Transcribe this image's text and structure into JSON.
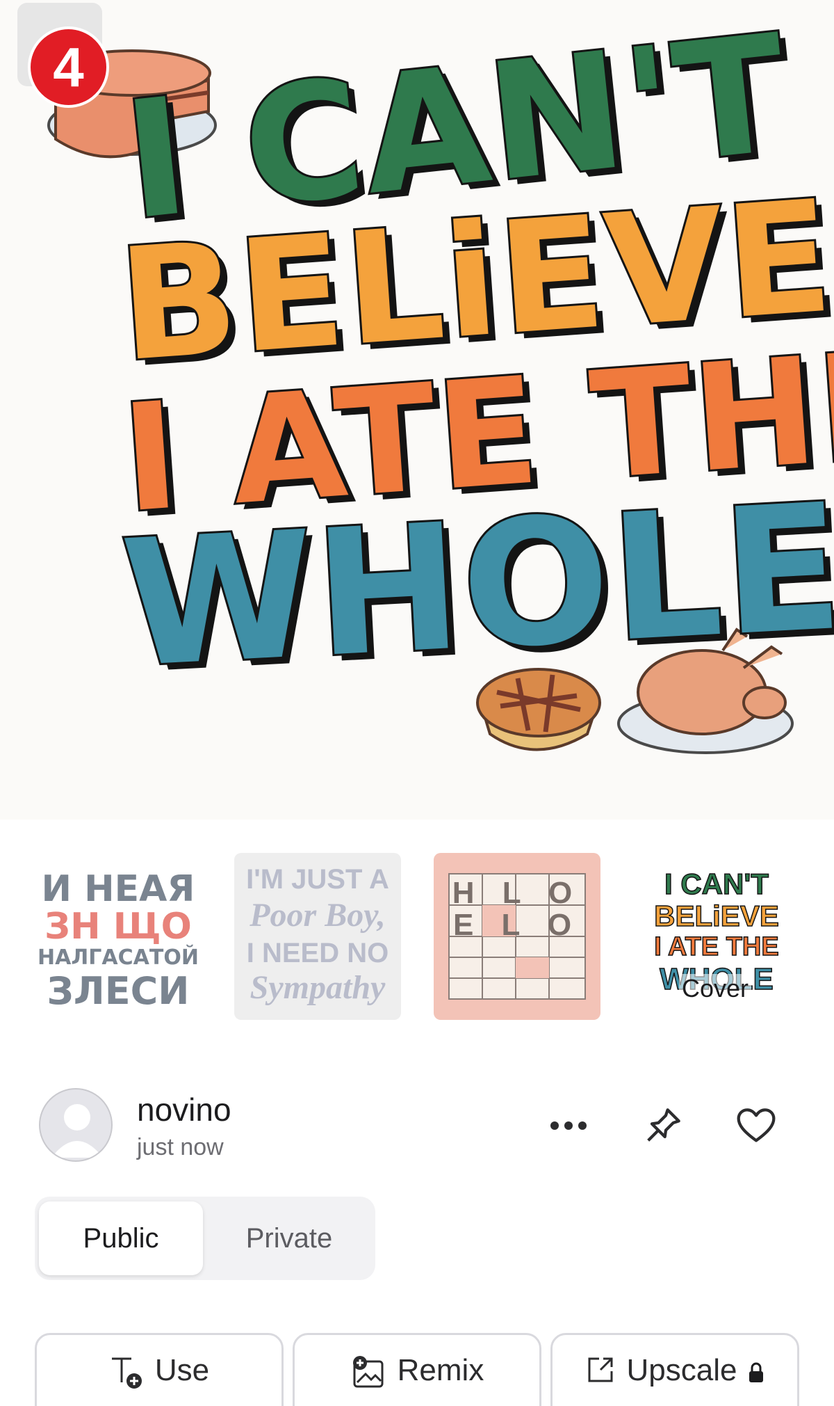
{
  "badge": {
    "count": "4"
  },
  "hero": {
    "lines": [
      "I CAN'T",
      "BELiEVE",
      "I ATE THE",
      "WHOLE"
    ]
  },
  "thumbnails": [
    {
      "lines": [
        "И НЕАЯ",
        "ЗН ЩО",
        "НАЛГАСАТОЙ",
        "ЗЛЕСИ"
      ],
      "colors": [
        "#7a8490",
        "#e8827a",
        "#7a8490",
        "#7a8490"
      ]
    },
    {
      "lines": [
        "I'M JUST A",
        "Poor Boy,",
        "I NEED NO",
        "Sympathy"
      ],
      "color": "#b9bccb"
    },
    {
      "lines": [
        "H  L O",
        "E  L O"
      ],
      "color": "#7a6f6a"
    },
    {
      "lines": [
        "I CAN'T",
        "BELiEVE",
        "I ATE THE",
        "WHOLE"
      ],
      "cover_label": "Cover"
    }
  ],
  "author": {
    "username": "novino",
    "timestamp": "just now"
  },
  "visibility": {
    "options": [
      "Public",
      "Private"
    ],
    "selected": "Public"
  },
  "actions": {
    "use_label": "Use",
    "remix_label": "Remix",
    "upscale_label": "Upscale"
  },
  "colors": {
    "badge": "#e11d25",
    "border": "#d9d9de",
    "segment_bg": "#f2f2f4"
  }
}
